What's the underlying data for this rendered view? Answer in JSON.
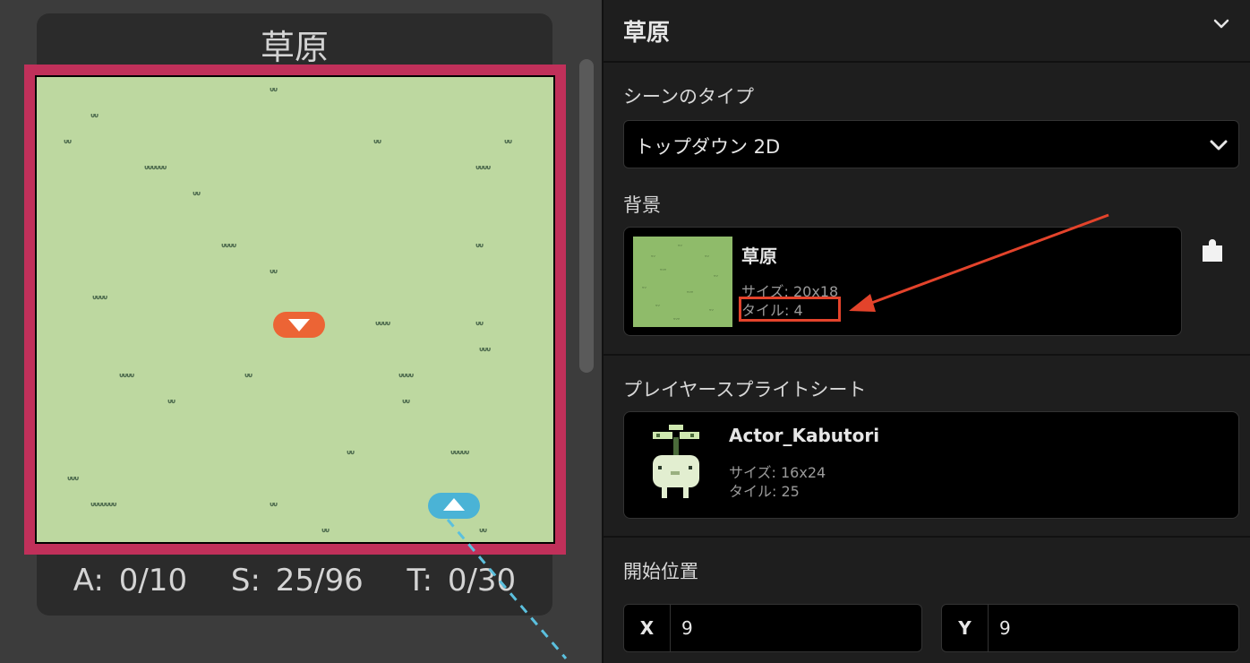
{
  "scene": {
    "title": "草原",
    "stats": {
      "actors": "A: 0/10",
      "sprites": "S: 25/96",
      "triggers": "T: 0/30"
    },
    "grass_glyph": "ᐡᐡ"
  },
  "panel": {
    "title": "草原",
    "scene_type": {
      "label": "シーンのタイプ",
      "value": "トップダウン 2D"
    },
    "background": {
      "label": "背景",
      "name": "草原",
      "size": "サイズ: 20x18",
      "tiles": "タイル: 4"
    },
    "player_sprite": {
      "label": "プレイヤースプライトシート",
      "name": "Actor_Kabutori",
      "size": "サイズ: 16x24",
      "tiles": "タイル: 25"
    },
    "start_position": {
      "label": "開始位置",
      "x_label": "X",
      "x_value": "9",
      "y_label": "Y",
      "y_value": "9"
    }
  },
  "colors": {
    "frame": "#c0305a",
    "map_bg": "#bdd8a0",
    "marker_down": "#ec6435",
    "marker_up": "#4ab3d6",
    "annotation": "#e3432b"
  },
  "icons": [
    "chevron-down-icon",
    "puzzle-icon",
    "arrow-annotation-icon"
  ]
}
